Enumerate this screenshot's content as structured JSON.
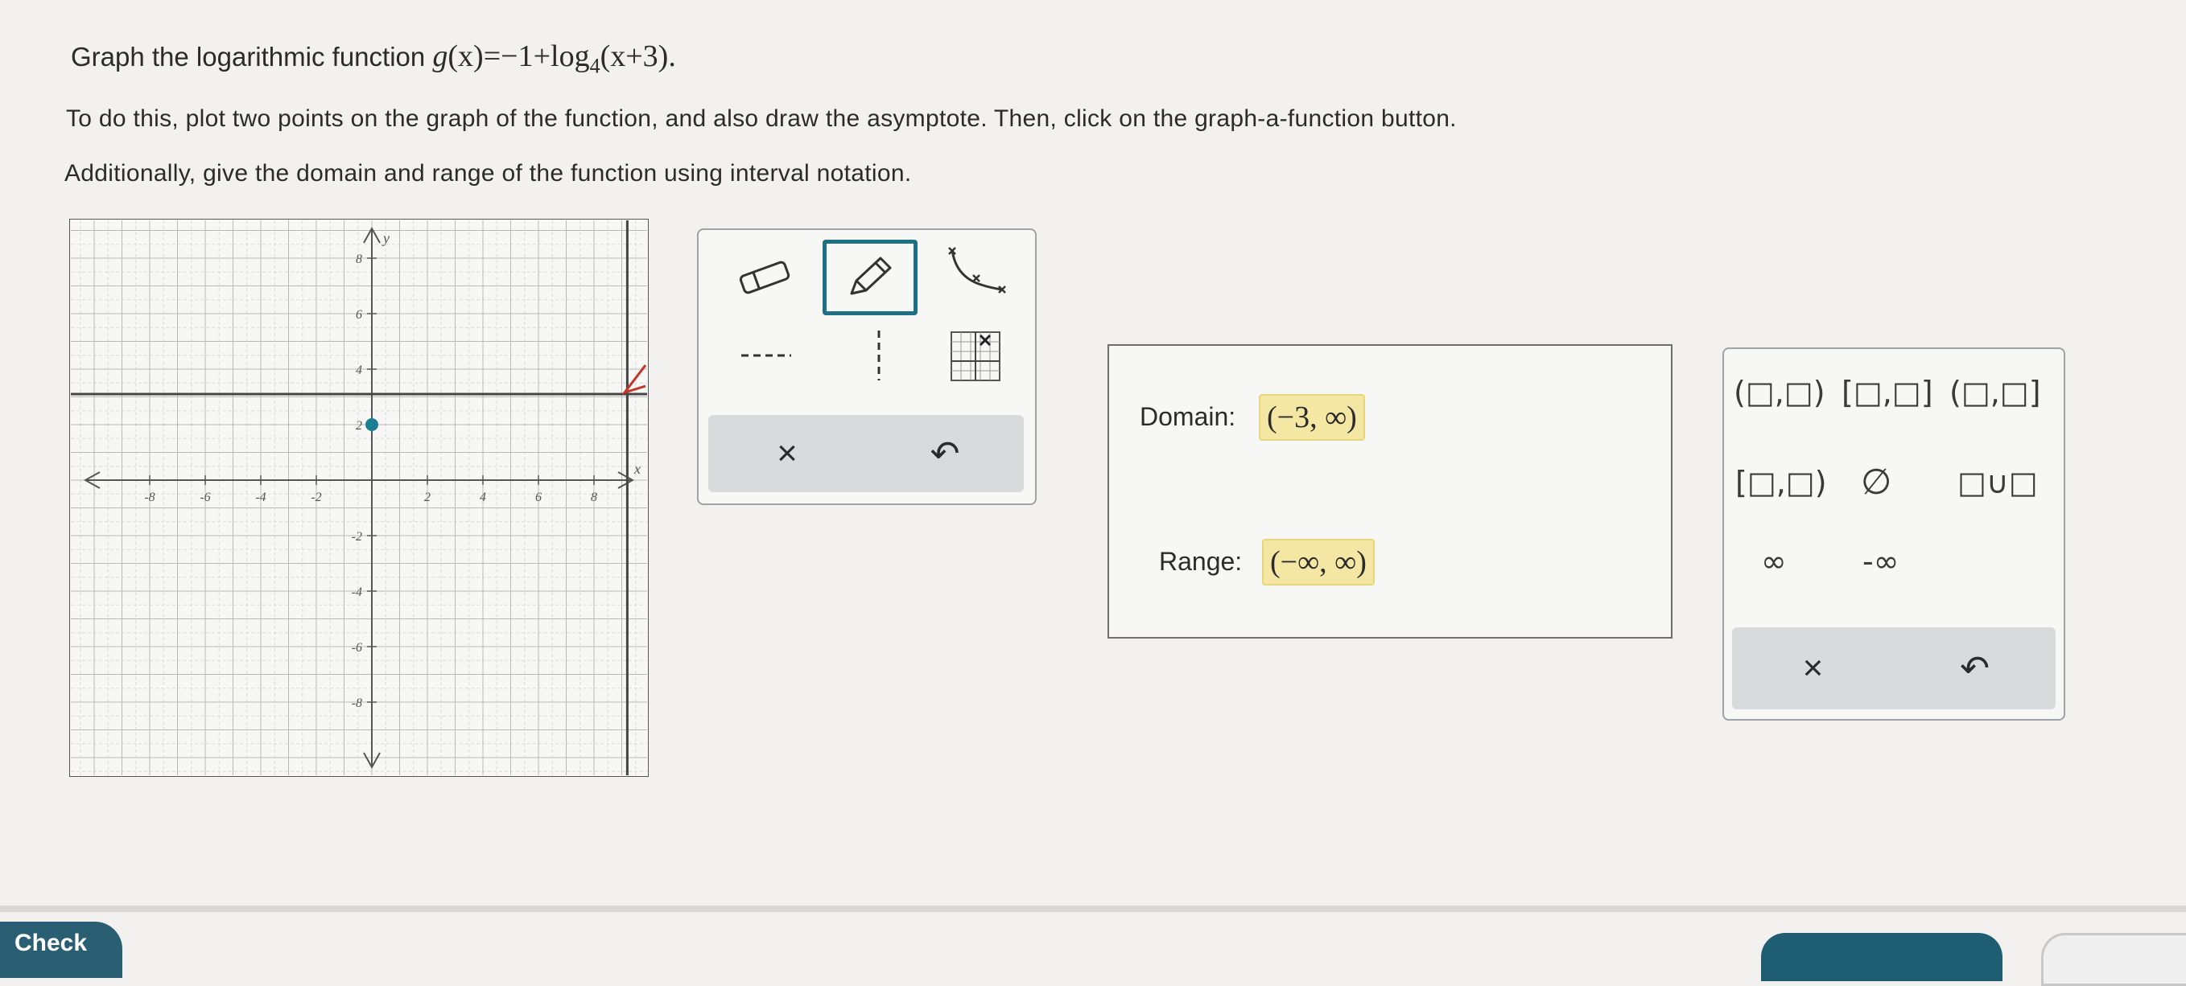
{
  "question": {
    "prefix": "Graph the logarithmic function",
    "fn_name": "g",
    "fn_arg": "(x)",
    "fn_body_pre": "=−1+log",
    "log_base": "4",
    "fn_body_post": "(x+3).",
    "instruction_1": "To do this, plot two points on the graph of the function, and also draw the asymptote. Then, click on the graph-a-function button.",
    "instruction_2": "Additionally, give the domain and range of the function using interval notation."
  },
  "graph": {
    "x_axis_label": "x",
    "y_axis_label": "y",
    "x_ticks": [
      "-8",
      "-6",
      "-4",
      "-2",
      "2",
      "4",
      "6",
      "8"
    ],
    "y_ticks": [
      "8",
      "6",
      "4",
      "2",
      "-2",
      "-4",
      "-6",
      "-8"
    ],
    "plotted_point": {
      "x": 0,
      "y": 2
    },
    "horizontal_line_y": 3.1,
    "asymptote_x": 9.2
  },
  "toolbar": {
    "tools": [
      "eraser-tool",
      "pencil-tool",
      "graph-a-function-tool",
      "dashed-horizontal-line-tool",
      "dashed-vertical-line-tool",
      "point-grid-tool"
    ],
    "clear_label": "×",
    "undo_label": "↶"
  },
  "answers": {
    "domain_label": "Domain:",
    "domain_value": "(−3, ∞)",
    "range_label": "Range:",
    "range_value": "(−∞, ∞)"
  },
  "palette": {
    "open_open": "(□,□)",
    "closed_closed": "[□,□]",
    "open_closed": "(□,□]",
    "closed_open": "[□,□)",
    "empty_set": "∅",
    "union": "□∪□",
    "infinity": "∞",
    "neg_infinity": "-∞",
    "clear_label": "×",
    "undo_label": "↶"
  },
  "footer": {
    "check_label": "Check"
  },
  "colors": {
    "accent": "#1f6f86",
    "answer_highlight": "#f3e7a3",
    "point": "#1a7f94",
    "arrow_marker": "#c0392b"
  }
}
